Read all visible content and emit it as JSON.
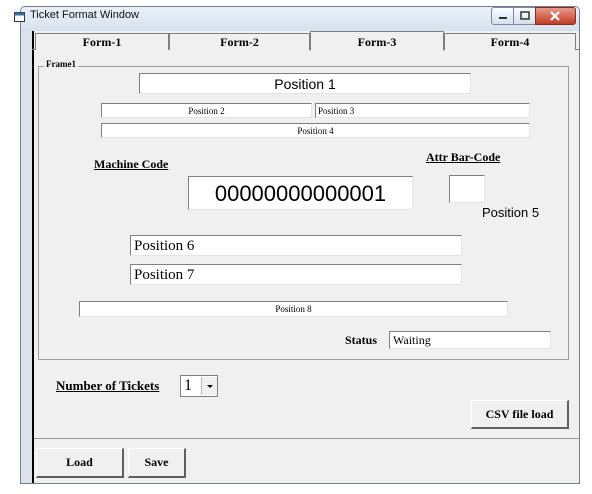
{
  "window": {
    "title": "Ticket Format Window"
  },
  "tabs": [
    "Form-1",
    "Form-2",
    "Form-3",
    "Form-4"
  ],
  "frame": {
    "label": "Frame1"
  },
  "positions": {
    "p1": "Position 1",
    "p2": "Position 2",
    "p3": "Position 3",
    "p4": "Position 4",
    "p5": "Position 5",
    "p6": "Position 6",
    "p7": "Position 7",
    "p8": "Position 8"
  },
  "machine_code": {
    "label": "Machine Code",
    "value": "00000000000001"
  },
  "barcode": {
    "label": "Attr Bar-Code",
    "value": ""
  },
  "status": {
    "label": "Status",
    "value": "Waiting"
  },
  "tickets": {
    "label": "Number of Tickets",
    "value": "1"
  },
  "buttons": {
    "csv": "CSV file load",
    "load": "Load",
    "save": "Save"
  },
  "icons": {
    "app": "ticket-app-icon",
    "dropdown": "chevron-down-icon"
  }
}
